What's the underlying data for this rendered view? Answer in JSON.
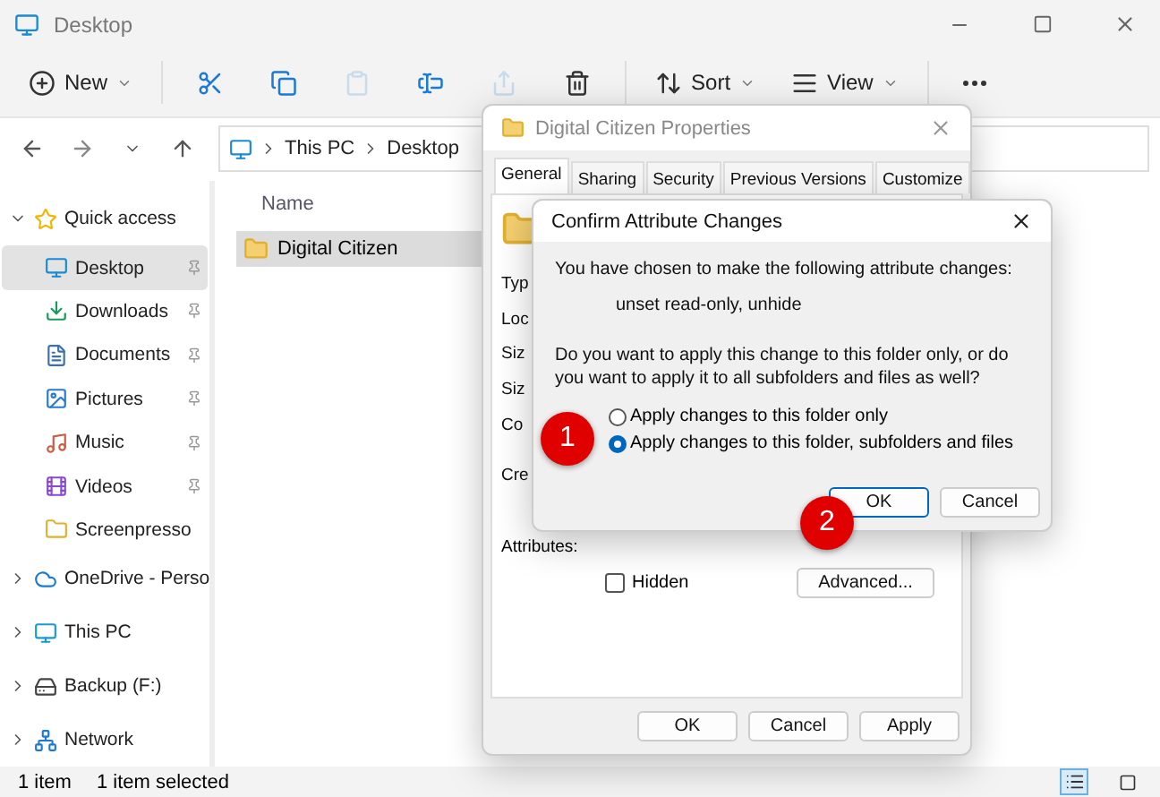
{
  "explorer": {
    "title": "Desktop",
    "toolbar": [
      {
        "kind": "new",
        "label": "New",
        "disabled": false
      },
      {
        "kind": "cut",
        "disabled": false
      },
      {
        "kind": "copy",
        "disabled": false
      },
      {
        "kind": "paste",
        "disabled": true
      },
      {
        "kind": "rename",
        "disabled": false
      },
      {
        "kind": "share",
        "disabled": true
      },
      {
        "kind": "delete",
        "disabled": false
      },
      {
        "kind": "sort",
        "label": "Sort",
        "disabled": false
      },
      {
        "kind": "view",
        "label": "View",
        "disabled": false
      },
      {
        "kind": "more",
        "disabled": false
      }
    ],
    "breadcrumb": [
      "This PC",
      "Desktop"
    ],
    "sidebar": [
      {
        "label": "Quick access",
        "expanded": true,
        "children": [
          {
            "label": "Desktop",
            "selected": true,
            "pinned": true
          },
          {
            "label": "Downloads",
            "selected": false,
            "pinned": true
          },
          {
            "label": "Documents",
            "selected": false,
            "pinned": true
          },
          {
            "label": "Pictures",
            "selected": false,
            "pinned": true
          },
          {
            "label": "Music",
            "selected": false,
            "pinned": true
          },
          {
            "label": "Videos",
            "selected": false,
            "pinned": true
          },
          {
            "label": "Screenpresso",
            "selected": false,
            "pinned": false
          }
        ]
      },
      {
        "label": "OneDrive - Perso",
        "expanded": false
      },
      {
        "label": "This PC",
        "expanded": false
      },
      {
        "label": "Backup (F:)",
        "expanded": false
      },
      {
        "label": "Network",
        "expanded": false
      }
    ],
    "column": "Name",
    "files": [
      {
        "name": "Digital Citizen",
        "selected": true
      }
    ],
    "status": [
      "1 item",
      "1 item selected"
    ],
    "views": [
      {
        "kind": "details",
        "selected": true
      },
      {
        "kind": "tiles",
        "selected": false
      }
    ]
  },
  "properties": {
    "title": "Digital Citizen Properties",
    "tabs": [
      {
        "label": "General",
        "selected": true
      },
      {
        "label": "Sharing",
        "selected": false
      },
      {
        "label": "Security",
        "selected": false
      },
      {
        "label": "Previous Versions",
        "selected": false
      },
      {
        "label": "Customize",
        "selected": false
      }
    ],
    "fields": [
      "Typ",
      "Loc",
      "Siz",
      "Siz",
      "Co",
      "Cre"
    ],
    "attributes_label": "Attributes:",
    "hidden": {
      "label": "Hidden",
      "checked": false
    },
    "advanced": "Advanced...",
    "buttons": [
      "OK",
      "Cancel",
      "Apply"
    ]
  },
  "confirm": {
    "title": "Confirm Attribute Changes",
    "message": "You have chosen to make the following attribute changes:",
    "changes": "unset read-only, unhide",
    "question": "Do you want to apply this change to this folder only, or do you want to apply it to all subfolders and files as well?",
    "options": [
      {
        "label": "Apply changes to this folder only",
        "selected": false
      },
      {
        "label": "Apply changes to this folder, subfolders and files",
        "selected": true
      }
    ],
    "buttons": [
      {
        "label": "OK",
        "default": true
      },
      {
        "label": "Cancel",
        "default": false
      }
    ]
  },
  "markers": [
    "1",
    "2"
  ]
}
